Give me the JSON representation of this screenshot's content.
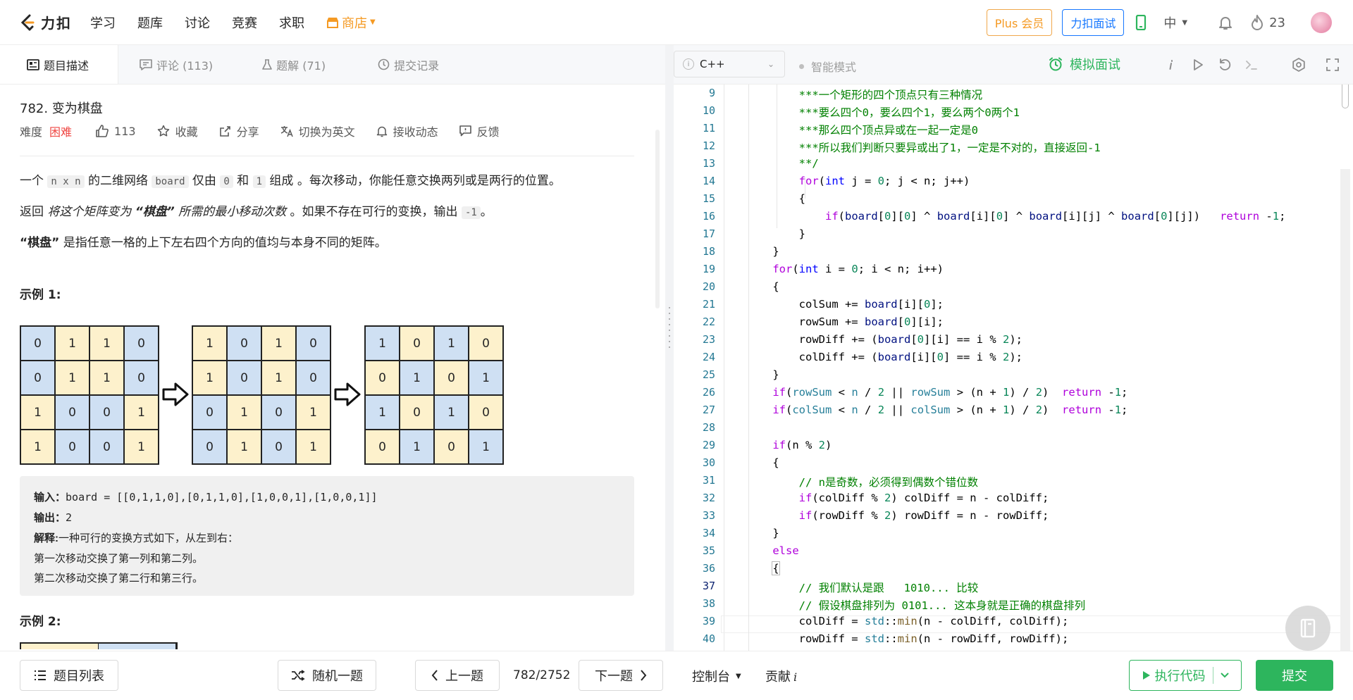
{
  "header": {
    "logo_text": "力扣",
    "nav": [
      "学习",
      "题库",
      "讨论",
      "竞赛",
      "求职"
    ],
    "shop_label": "商店",
    "plus_label": "Plus 会员",
    "interview_label": "力扣面试",
    "lang_label": "中",
    "streak_count": "23"
  },
  "tabs": {
    "description": "题目描述",
    "comments": "评论 (113)",
    "solutions": "题解 (71)",
    "submissions": "提交记录"
  },
  "problem": {
    "title": "782. 变为棋盘",
    "difficulty_label": "难度",
    "difficulty": "困难",
    "likes": "113",
    "favorite": "收藏",
    "share": "分享",
    "switch_en": "切换为英文",
    "subscribe": "接收动态",
    "feedback": "反馈",
    "desc1_a": "一个 ",
    "desc1_code1": "n x n",
    "desc1_b": " 的二维网络 ",
    "desc1_code2": "board",
    "desc1_c": " 仅由 ",
    "desc1_code3": "0",
    "desc1_d": " 和 ",
    "desc1_code4": "1",
    "desc1_e": " 组成 。每次移动，你能任意交换两列或是两行的位置。",
    "desc2_a": "返回 ",
    "desc2_em1": "将这个矩阵变为 ",
    "desc2_strong": "“棋盘”",
    "desc2_em2": " 所需的最小移动次数",
    "desc2_b": " 。如果不存在可行的变换，输出 ",
    "desc2_code": "-1",
    "desc2_c": "。",
    "desc3_strong": "“棋盘”",
    "desc3_rest": " 是指任意一格的上下左右四个方向的值均与本身不同的矩阵。",
    "example1_title": "示例 1:",
    "example2_title": "示例 2:",
    "input_label": "输入：",
    "input_value": "board = [[0,1,1,0],[0,1,1,0],[1,0,0,1],[1,0,0,1]]",
    "output_label": "输出：",
    "output_value": "2",
    "explain_label": "解释:",
    "explain_value": "一种可行的变换方式如下，从左到右：",
    "explain_line2": "第一次移动交换了第一列和第二列。",
    "explain_line3": "第二次移动交换了第二行和第三行。"
  },
  "grids": [
    {
      "values": [
        "0",
        "1",
        "1",
        "0",
        "0",
        "1",
        "1",
        "0",
        "1",
        "0",
        "0",
        "1",
        "1",
        "0",
        "0",
        "1"
      ],
      "colors": [
        "b",
        "y",
        "y",
        "b",
        "b",
        "y",
        "y",
        "b",
        "y",
        "b",
        "b",
        "y",
        "y",
        "b",
        "b",
        "y"
      ]
    },
    {
      "values": [
        "1",
        "0",
        "1",
        "0",
        "1",
        "0",
        "1",
        "0",
        "0",
        "1",
        "0",
        "1",
        "0",
        "1",
        "0",
        "1"
      ],
      "colors": [
        "y",
        "b",
        "y",
        "b",
        "y",
        "b",
        "y",
        "b",
        "b",
        "y",
        "b",
        "y",
        "b",
        "y",
        "b",
        "y"
      ]
    },
    {
      "values": [
        "1",
        "0",
        "1",
        "0",
        "0",
        "1",
        "0",
        "1",
        "1",
        "0",
        "1",
        "0",
        "0",
        "1",
        "0",
        "1"
      ],
      "colors": [
        "b",
        "y",
        "b",
        "y",
        "y",
        "b",
        "y",
        "b",
        "b",
        "y",
        "b",
        "y",
        "y",
        "b",
        "y",
        "b"
      ]
    }
  ],
  "editor": {
    "language": "C++",
    "smart_mode": "智能模式",
    "mock_interview": "模拟面试",
    "line_numbers": [
      "9",
      "10",
      "11",
      "12",
      "13",
      "14",
      "15",
      "16",
      "17",
      "18",
      "19",
      "20",
      "21",
      "22",
      "23",
      "24",
      "25",
      "26",
      "27",
      "28",
      "29",
      "30",
      "31",
      "32",
      "33",
      "34",
      "35",
      "36",
      "37",
      "38",
      "39",
      "40"
    ],
    "current_line": "37"
  },
  "bottom": {
    "problem_list": "题目列表",
    "random": "随机一题",
    "prev": "上一题",
    "page_index": "782/2752",
    "next": "下一题",
    "console": "控制台",
    "contribute": "贡献",
    "run": "执行代码",
    "submit": "提交"
  },
  "colors": {
    "accent_green": "#2db55d",
    "hard_red": "#ef4743",
    "shop_orange": "#f59a23",
    "link_blue": "#1677ff"
  }
}
